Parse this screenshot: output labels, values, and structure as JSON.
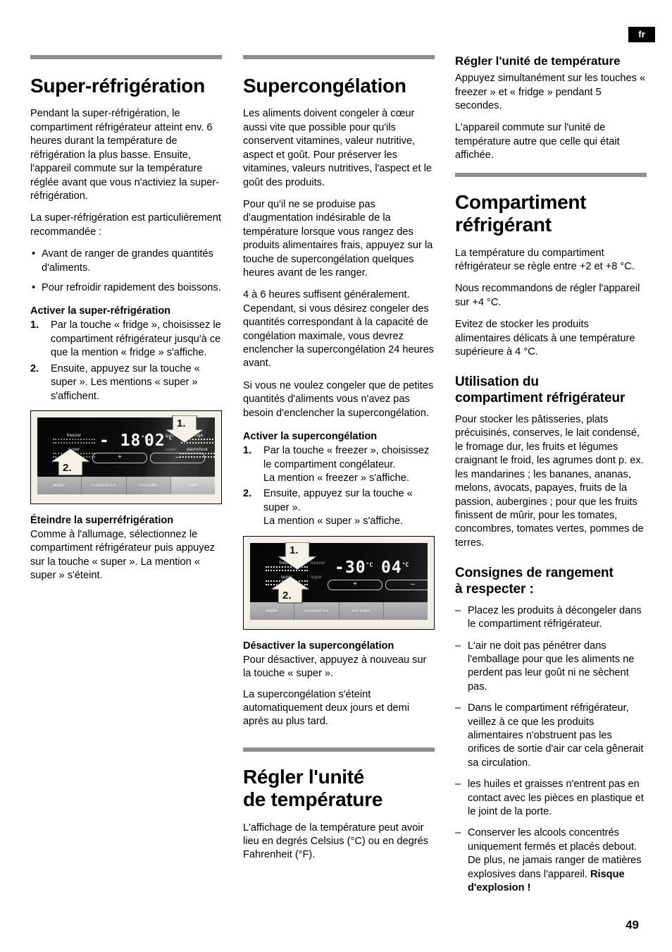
{
  "meta": {
    "language_tag": "fr",
    "page_number": "49"
  },
  "column1": {
    "title": "Super-réfrigération",
    "p1": "Pendant la super-réfrigération, le compartiment réfrigérateur atteint env. 6 heures durant la température de réfrigération la plus basse. Ensuite, l'appareil commute sur la température réglée avant que vous n'activiez la super-réfrigération.",
    "p2": "La super-réfrigération est particulièrement recommandée :",
    "bullets": [
      "Avant de ranger de grandes quantités d'aliments.",
      "Pour refroidir rapidement des boissons."
    ],
    "activate_heading": "Activer la super-réfrigération",
    "steps": [
      {
        "num": "1.",
        "text": "Par la touche « fridge », choisissez le compartiment réfrigérateur jusqu'à ce que la mention « fridge » s'affiche."
      },
      {
        "num": "2.",
        "text": "Ensuite, appuyez sur la touche « super ». Les mentions « super » s'affichent."
      }
    ],
    "off_heading": "Éteindre la superréfrigération",
    "off_text": "Comme à l'allumage, sélectionnez le compartiment réfrigérateur puis appuyez sur la touche « super ». La mention « super » s'éteint."
  },
  "figure1": {
    "name": "control-panel-fridge",
    "labels": {
      "freezer": "freezer",
      "super_left": "super",
      "fridge_small": "fridge",
      "fridge_lit": "fridge",
      "super_small": "super",
      "alarm_lock": "alarm/lock"
    },
    "temps": {
      "freezer_value": "- 18",
      "freezer_unit": "°C",
      "fridge_value": "02",
      "fridge_unit": "°C"
    },
    "plus": "+",
    "minus": "–",
    "buttons": [
      "water",
      "crushed ice",
      "ice cube",
      "light"
    ],
    "callouts": [
      "1.",
      "2."
    ]
  },
  "column2": {
    "title": "Supercongélation",
    "p1": "Les aliments doivent congeler à cœur aussi vite que possible pour qu'ils conservent vitamines, valeur nutritive, aspect et goût. Pour préserver les vitamines, valeurs nutritives, l'aspect et le goût des produits.",
    "p2": "Pour qu'il ne se produise pas d'augmentation indésirable de la température lorsque vous rangez des produits alimentaires frais, appuyez sur la touche de supercongélation quelques heures avant de les ranger.",
    "p3": "4 à 6 heures suffisent généralement. Cependant, si vous désirez congeler des quantités correspondant à la capacité de congélation maximale, vous devrez enclencher la supercongélation 24 heures avant.",
    "p4": "Si vous ne voulez congeler que de petites quantités d'aliments vous n'avez pas besoin d'enclencher la supercongélation.",
    "activate_heading": "Activer la supercongélation",
    "steps": [
      {
        "num": "1.",
        "text": "Par la touche « freezer », choisissez le compartiment congélateur.\nLa mention « freezer » s'affiche."
      },
      {
        "num": "2.",
        "text": "Ensuite, appuyez sur la touche « super ».\nLa mention « super » s'affiche."
      }
    ],
    "off_heading": "Désactiver la supercongélation",
    "off_text1": "Pour désactiver, appuyez à nouveau sur la touche « super ».",
    "off_text2": "La supercongélation s'éteint automatiquement deux jours et demi après au plus tard.",
    "unit_title": "Régler l'unité\nde température",
    "unit_text": "L'affichage de la température peut avoir lieu en degrés Celsius (°C) ou en degrés Fahrenheit (°F)."
  },
  "figure2": {
    "name": "control-panel-freezer",
    "labels": {
      "freezer_lit": "freezer",
      "freezer_small": "freezer",
      "super_lit": "super",
      "super_small": "super"
    },
    "temps": {
      "freezer_value": "-30",
      "freezer_unit": "°C",
      "fridge_value": "04",
      "fridge_unit": "°C"
    },
    "plus": "+",
    "minus": "–",
    "buttons": [
      "water",
      "crushed ice",
      "ice cube"
    ],
    "callouts": [
      "1.",
      "2."
    ]
  },
  "column3": {
    "unit_heading": "Régler l'unité de température",
    "unit_p1": "Appuyez simultanément sur les touches « freezer » et « fridge » pendant 5 secondes.",
    "unit_p2": "L'appareil commute sur l'unité de température autre que celle qui était affichée.",
    "title": "Compartiment\nréfrigérant",
    "p1": "La température du compartiment réfrigérateur se règle entre +2 et +8 °C.",
    "p2": "Nous recommandons de régler l'appareil sur +4 °C.",
    "p3": "Evitez de stocker les produits alimentaires délicats à une température supérieure à 4 °C.",
    "use_heading": "Utilisation du\ncompartiment réfrigérateur",
    "use_text": "Pour stocker les pâtisseries, plats précuisinés, conserves, le lait condensé, le fromage dur, les fruits et légumes craignant le froid, les agrumes dont p. ex. les mandarines ; les bananes, ananas, melons, avocats, papayes, fruits de la passion, aubergines ; pour que les fruits finissent de mûrir, pour les tomates, concombres, tomates vertes, pommes de terres.",
    "storage_heading": "Consignes de rangement\nà respecter :",
    "storage_items": [
      "Placez les produits à décongeler dans le compartiment réfrigérateur.",
      "L'air ne doit pas pénétrer dans l'emballage pour que les aliments ne perdent pas leur goût ni ne sèchent pas.",
      "Dans le compartiment réfrigérateur, veillez à ce que les produits alimentaires n'obstruent pas les orifices de sortie d'air car cela gênerait sa circulation.",
      "les huiles et graisses n'entrent pas en contact avec les pièces en plastique et le joint de la porte."
    ],
    "storage_last": "Conserver les alcools concentrés uniquement fermés et placés debout. De plus, ne jamais ranger de matières explosives dans l'appareil.",
    "storage_last_bold": "Risque d'explosion !"
  }
}
